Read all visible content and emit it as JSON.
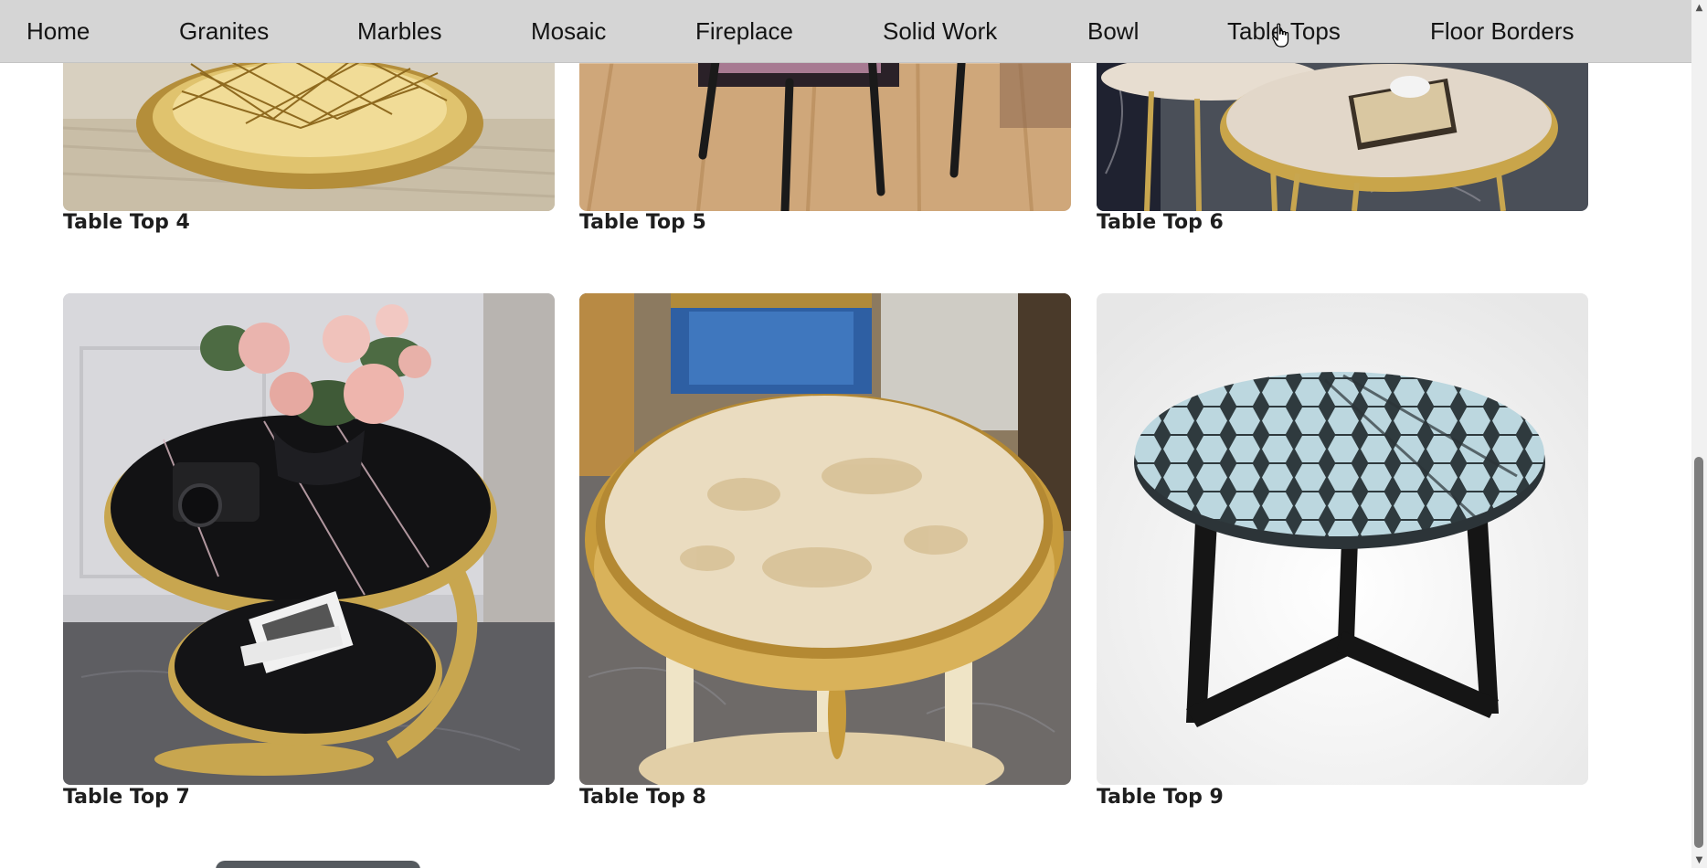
{
  "nav": {
    "items": [
      {
        "label": "Home"
      },
      {
        "label": "Granites"
      },
      {
        "label": "Marbles"
      },
      {
        "label": "Mosaic"
      },
      {
        "label": "Fireplace"
      },
      {
        "label": "Solid Work"
      },
      {
        "label": "Bowl"
      },
      {
        "label": "Table Tops"
      },
      {
        "label": "Floor Borders"
      }
    ]
  },
  "products": [
    {
      "label": "Table Top 4"
    },
    {
      "label": "Table Top 5"
    },
    {
      "label": "Table Top 6"
    },
    {
      "label": "Table Top 7"
    },
    {
      "label": "Table Top 8"
    },
    {
      "label": "Table Top 9"
    }
  ],
  "colors": {
    "nav_background": "#d5d5d5",
    "scrollbar_thumb": "#7d7d7d"
  },
  "icons": {
    "cursor": "hand-pointer-icon",
    "scroll_up": "triangle-up-icon",
    "scroll_down": "triangle-down-icon"
  }
}
